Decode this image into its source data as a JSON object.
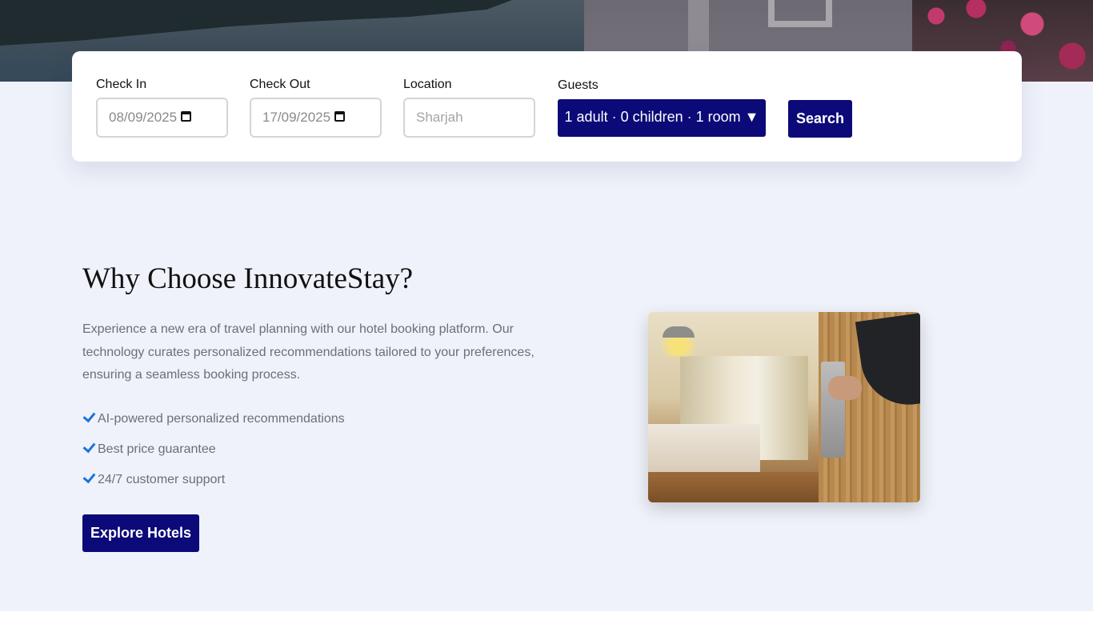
{
  "search": {
    "check_in_label": "Check In",
    "check_in_value": "08/09/2025",
    "check_out_label": "Check Out",
    "check_out_value": "17/09/2025",
    "location_label": "Location",
    "location_placeholder": "Sharjah",
    "guests_label": "Guests",
    "guests_value": "1 adult · 0 children · 1 room ▼",
    "search_label": "Search"
  },
  "why": {
    "title": "Why Choose InnovateStay?",
    "description": "Experience a new era of travel planning with our hotel booking platform. Our technology curates personalized recommendations tailored to your preferences, ensuring a seamless booking process.",
    "features": [
      "AI-powered personalized recommendations",
      "Best price guarantee",
      "24/7 customer support"
    ],
    "cta_label": "Explore Hotels"
  },
  "icons": {
    "calendar": "calendar-icon",
    "check": "check-icon"
  },
  "colors": {
    "primary": "#0b0a78",
    "accent_check": "#1b73d8",
    "section_bg": "#eff2fa"
  }
}
